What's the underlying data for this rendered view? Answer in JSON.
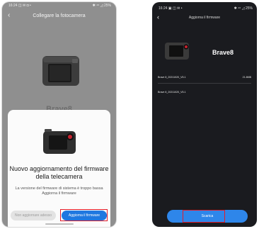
{
  "left_screen": {
    "status_time": "16:24",
    "status_icons_left": "◫ ✉ ◘ •",
    "status_right": "✱ ⁴⁶ ◿ 25%",
    "title": "Collegare la fotocamera",
    "background_model": "Brave8",
    "dialog": {
      "heading": "Nuovo aggiornamento del firmware della telecamera",
      "message": "La versione del firmware di sistema è troppo bassa Aggiorna il firmware",
      "later_button": "Non aggiornare adesso",
      "update_button": "Aggiorna il firmware"
    }
  },
  "right_screen": {
    "status_time": "16:24",
    "status_icons_left": "▣ ◫ ✉ •",
    "status_right": "✱ ⁴⁶ ◿ 25%",
    "title": "Aggiorna il firmware",
    "model": "Brave8",
    "firmware_current": "Brave 8_20211020_V5.1",
    "firmware_size": "21.8MB",
    "firmware_new": "Brave 8_20211020_V5.1",
    "download_button": "Scarica"
  },
  "colors": {
    "highlight": "#e21c2a",
    "primary_blue": "#1f78e0",
    "dark_bg": "#1a1b1f"
  }
}
